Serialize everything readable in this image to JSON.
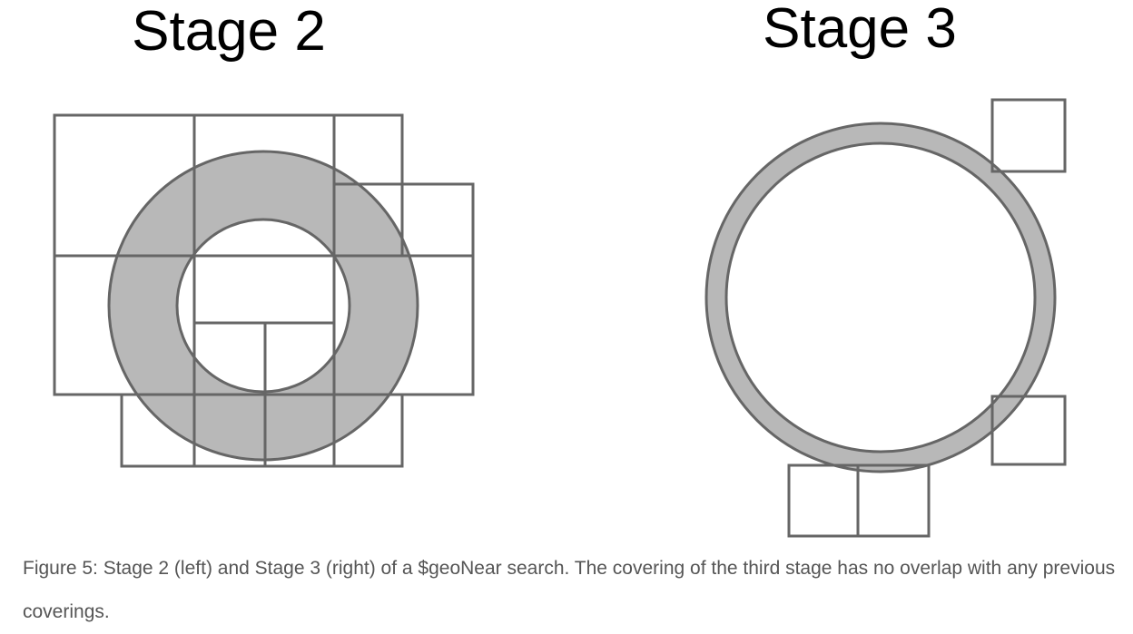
{
  "figure": {
    "panels": [
      {
        "title": "Stage 2"
      },
      {
        "title": "Stage 3"
      }
    ],
    "colors": {
      "annulus_fill": "#b8b8b8",
      "stroke": "#666666",
      "background": "#ffffff"
    }
  },
  "caption": "Figure 5: Stage 2 (left) and Stage 3 (right) of a $geoNear search. The covering of the third stage has no overlap with any previous coverings."
}
